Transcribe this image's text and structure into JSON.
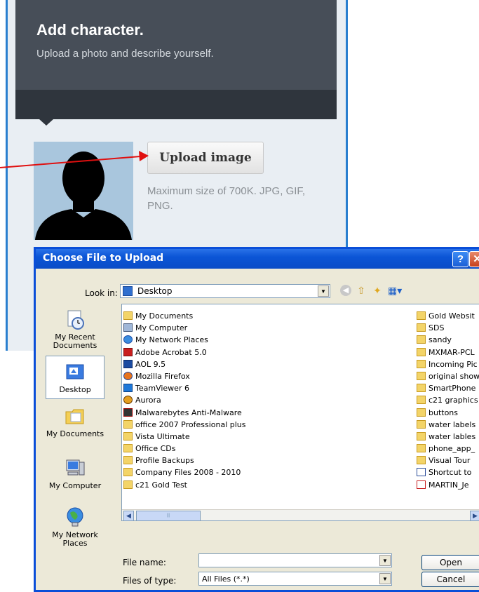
{
  "web": {
    "title": "Add character.",
    "subtitle": "Upload a photo and describe yourself.",
    "upload_button": "Upload image",
    "size_hint": "Maximum size of 700K. JPG, GIF, PNG."
  },
  "dialog": {
    "title": "Choose File to Upload",
    "help_glyph": "?",
    "close_glyph": "✕",
    "look_in_label": "Look in:",
    "look_in_value": "Desktop",
    "file_name_label": "File name:",
    "file_name_value": "",
    "files_of_type_label": "Files of type:",
    "files_of_type_value": "All Files (*.*)",
    "open_button": "Open",
    "cancel_button": "Cancel",
    "places": [
      {
        "label": "My Recent Documents",
        "icon": "recent-documents-icon"
      },
      {
        "label": "Desktop",
        "icon": "desktop-icon"
      },
      {
        "label": "My Documents",
        "icon": "my-documents-icon"
      },
      {
        "label": "My Computer",
        "icon": "my-computer-icon"
      },
      {
        "label": "My Network Places",
        "icon": "network-places-icon"
      }
    ],
    "files_left": [
      {
        "name": "My Documents",
        "icon": "my-documents"
      },
      {
        "name": "My Computer",
        "icon": "computer"
      },
      {
        "name": "My Network Places",
        "icon": "network"
      },
      {
        "name": "Adobe Acrobat 5.0",
        "icon": "acrobat"
      },
      {
        "name": "AOL 9.5",
        "icon": "aol"
      },
      {
        "name": "Mozilla Firefox",
        "icon": "firefox"
      },
      {
        "name": "TeamViewer 6",
        "icon": "teamviewer"
      },
      {
        "name": "Aurora",
        "icon": "aurora"
      },
      {
        "name": "Malwarebytes Anti-Malware",
        "icon": "malwarebytes"
      },
      {
        "name": "office 2007 Professional plus",
        "icon": "folder"
      },
      {
        "name": "Vista Ultimate",
        "icon": "folder"
      },
      {
        "name": "Office CDs",
        "icon": "folder"
      },
      {
        "name": "Profile Backups",
        "icon": "folder"
      },
      {
        "name": "Company Files 2008 - 2010",
        "icon": "folder"
      },
      {
        "name": "c21 Gold Test",
        "icon": "folder"
      }
    ],
    "files_right": [
      {
        "name": "Gold Websit",
        "icon": "folder"
      },
      {
        "name": "SDS",
        "icon": "folder"
      },
      {
        "name": "sandy",
        "icon": "folder"
      },
      {
        "name": "MXMAR-PCL",
        "icon": "folder"
      },
      {
        "name": "Incoming Pic",
        "icon": "folder"
      },
      {
        "name": "original show",
        "icon": "folder"
      },
      {
        "name": "SmartPhone",
        "icon": "folder"
      },
      {
        "name": "c21 graphics",
        "icon": "folder"
      },
      {
        "name": "buttons",
        "icon": "folder"
      },
      {
        "name": "water labels",
        "icon": "folder"
      },
      {
        "name": "water lables",
        "icon": "folder"
      },
      {
        "name": "phone_app_",
        "icon": "folder"
      },
      {
        "name": "Visual Tour",
        "icon": "folder"
      },
      {
        "name": "Shortcut to",
        "icon": "shortcut"
      },
      {
        "name": "MARTIN_Je",
        "icon": "pdf"
      }
    ]
  },
  "colors": {
    "web_header": "#474e58",
    "xp_title_blue": "#0a4ed8",
    "annotation_arrow": "#e01010"
  }
}
